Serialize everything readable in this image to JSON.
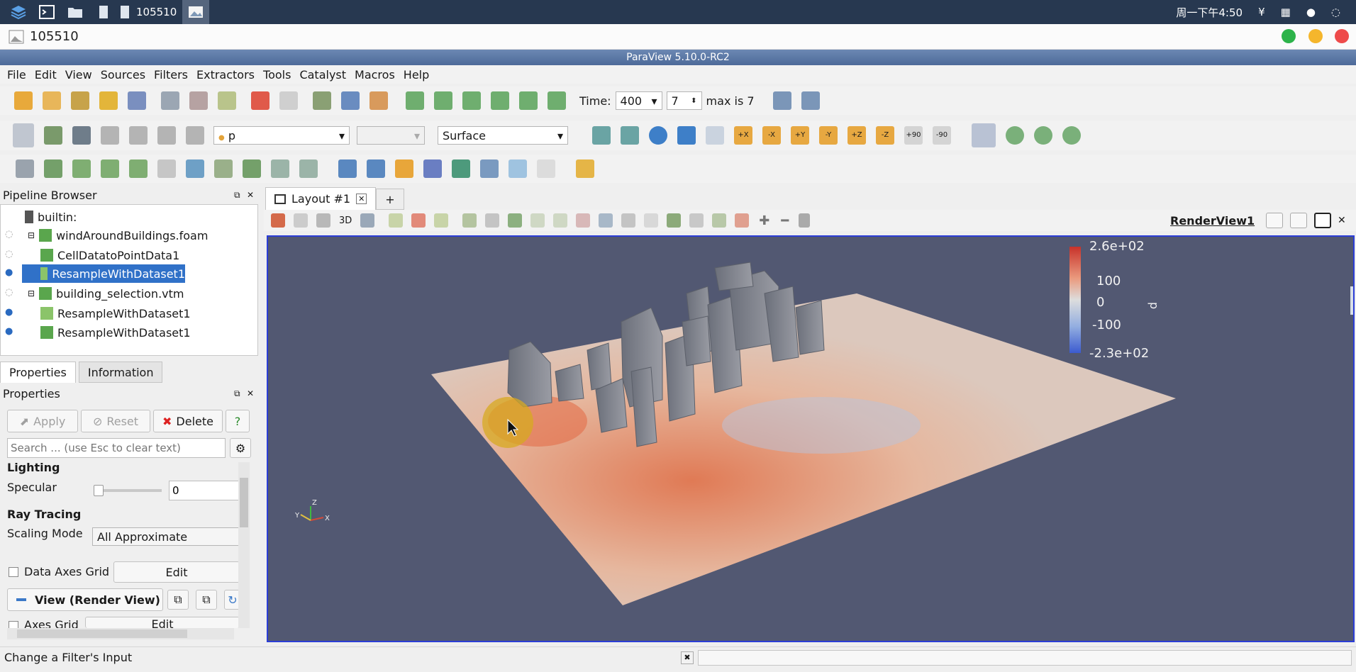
{
  "os_bar": {
    "task_title": "105510",
    "clock": "周一下午4:50"
  },
  "image_viewer": {
    "title": "105510"
  },
  "app": {
    "title": "ParaView 5.10.0-RC2"
  },
  "menu": [
    "File",
    "Edit",
    "View",
    "Sources",
    "Filters",
    "Extractors",
    "Tools",
    "Catalyst",
    "Macros",
    "Help"
  ],
  "time_toolbar": {
    "time_label": "Time:",
    "time_value": "400",
    "step_value": "7",
    "max_label": "max is 7"
  },
  "display_toolbar": {
    "array_value": "p",
    "representation": "Surface",
    "camera_labels": [
      "+X",
      "-X",
      "+Y",
      "-Y",
      "+Z",
      "-Z",
      "+90",
      "-90"
    ]
  },
  "pipeline": {
    "header": "Pipeline Browser",
    "items": [
      {
        "label": "builtin:",
        "visible": null,
        "indent": 0
      },
      {
        "label": "windAroundBuildings.foam",
        "visible": false,
        "indent": 1
      },
      {
        "label": "CellDatatoPointData1",
        "visible": false,
        "indent": 2
      },
      {
        "label": "ResampleWithDataset1",
        "visible": true,
        "indent": 2,
        "selected": true
      },
      {
        "label": "building_selection.vtm",
        "visible": false,
        "indent": 1
      },
      {
        "label": "ResampleWithDataset1",
        "visible": true,
        "indent": 2
      },
      {
        "label": "ResampleWithDataset1",
        "visible": true,
        "indent": 2
      }
    ]
  },
  "properties": {
    "tabs": [
      "Properties",
      "Information"
    ],
    "header": "Properties",
    "apply": "Apply",
    "reset": "Reset",
    "delete": "Delete",
    "help": "?",
    "search_placeholder": "Search ... (use Esc to clear text)",
    "lighting": "Lighting",
    "specular_label": "Specular",
    "specular_value": "0",
    "ray_tracing": "Ray Tracing",
    "scaling_mode_label": "Scaling Mode",
    "scaling_mode_value": "All Approximate",
    "data_axes_grid": "Data Axes Grid",
    "edit": "Edit",
    "view_section": "View (Render View)",
    "axes_grid": "Axes Grid"
  },
  "layout": {
    "tab": "Layout #1",
    "plus": "+",
    "threed": "3D",
    "render_view": "RenderView1"
  },
  "color_legend": {
    "labels": [
      "2.6e+02",
      "100",
      "0",
      "-100",
      "-2.3e+02"
    ],
    "title": "p"
  },
  "status": {
    "text": "Change a Filter's Input"
  },
  "colors": {
    "accent": "#3c8ad8",
    "viewport_bg": "#525872",
    "selection": "#3071c8"
  }
}
